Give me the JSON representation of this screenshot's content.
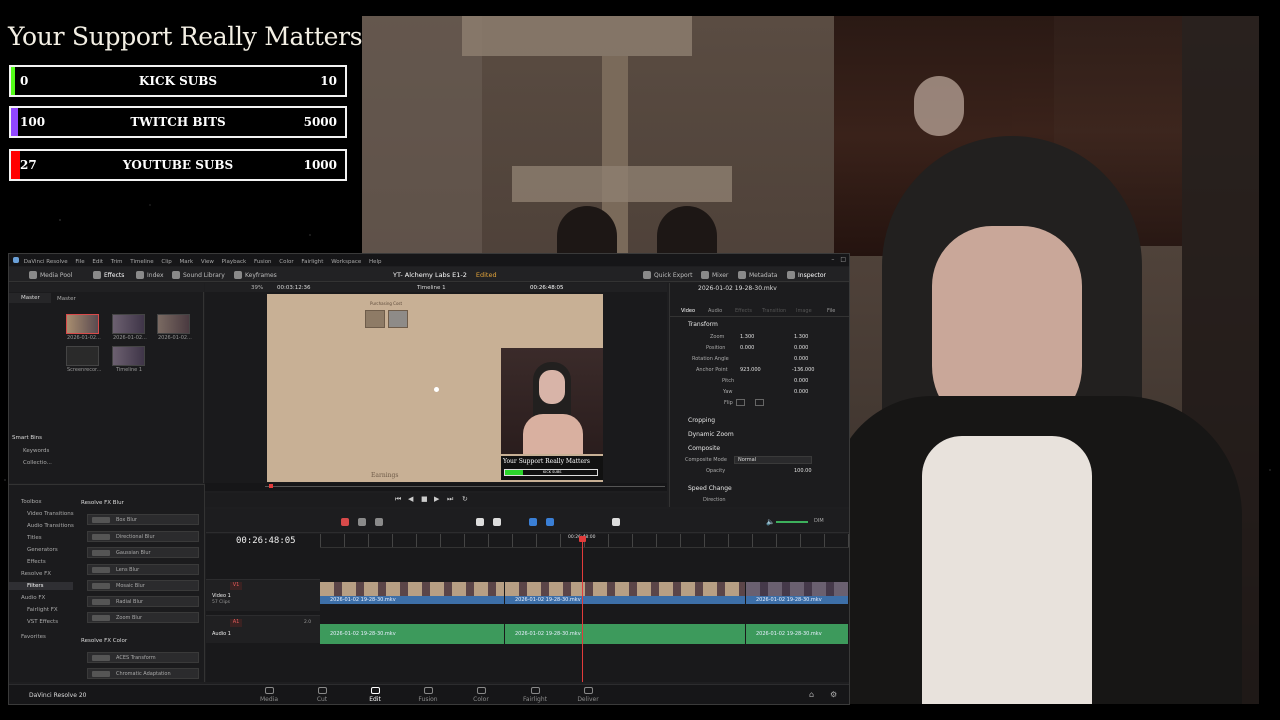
{
  "overlay": {
    "title": "Your Support Really Matters",
    "goals": [
      {
        "current": "0",
        "label": "KICK SUBS",
        "target": "10",
        "progress": 0,
        "color": "#53fc18"
      },
      {
        "current": "100",
        "label": "TWITCH BITS",
        "target": "5000",
        "progress": 0.02,
        "color": "#9146ff"
      },
      {
        "current": "27",
        "label": "YOUTUBE SUBS",
        "target": "1000",
        "progress": 0.027,
        "color": "#ff0000"
      }
    ]
  },
  "resolve": {
    "app_name": "DaVinci Resolve",
    "menu": [
      "DaVinci Resolve",
      "File",
      "Edit",
      "Trim",
      "Timeline",
      "Clip",
      "Mark",
      "View",
      "Playback",
      "Fusion",
      "Color",
      "Fairlight",
      "Workspace",
      "Help"
    ],
    "project_title": "YT- Alchemy Labs E1-2",
    "project_status": "Edited",
    "toolbar_left": [
      "Media Pool",
      "Effects",
      "Index",
      "Sound Library",
      "Keyframes"
    ],
    "toolbar_right": [
      "Quick Export",
      "Mixer",
      "Metadata",
      "Inspector"
    ],
    "bins": {
      "master": "Master",
      "crumb": "Master"
    },
    "media_clips": [
      "2026-01-02...",
      "2026-01-02...",
      "2026-01-02...",
      "Screenrecor...",
      "Timeline 1"
    ],
    "smart_bins": {
      "header": "Smart Bins",
      "items": [
        "Keywords",
        "Collectio..."
      ]
    },
    "viewer": {
      "zoom": "39%",
      "source_tc": "00:03:12:36",
      "timeline_name": "Timeline 1",
      "record_tc": "00:26:48:05",
      "game_top_text": "Purchasing Cost",
      "game_bottom_text": "Earnings",
      "inset_overlay_title": "Your Support Really Matters",
      "inset_goal_label": "KICK SUBS"
    },
    "inspector": {
      "clip_name": "2026-01-02 19-28-30.mkv",
      "tabs": [
        "Video",
        "Audio",
        "Effects",
        "Transition",
        "Image",
        "File"
      ],
      "transform": {
        "header": "Transform",
        "rows": [
          {
            "label": "Zoom",
            "x": "1.300",
            "y": "1.300"
          },
          {
            "label": "Position",
            "x": "0.000",
            "y": "0.000"
          },
          {
            "label": "Rotation Angle",
            "v": "0.000"
          },
          {
            "label": "Anchor Point",
            "x": "923.000",
            "y": "-136.000"
          },
          {
            "label": "Pitch",
            "v": "0.000"
          },
          {
            "label": "Yaw",
            "v": "0.000"
          },
          {
            "label": "Flip",
            "v": ""
          }
        ]
      },
      "sections": [
        "Cropping",
        "Dynamic Zoom",
        "Composite",
        "Speed Change"
      ],
      "composite_mode_label": "Composite Mode",
      "composite_mode": "Normal",
      "opacity_label": "Opacity",
      "opacity": "100.00",
      "direction_label": "Direction"
    },
    "toolbox": {
      "tree": [
        "Toolbox",
        "Video Transitions",
        "Audio Transitions",
        "Titles",
        "Generators",
        "Effects",
        "Resolve FX",
        "Filters",
        "Audio FX",
        "Fairlight FX",
        "VST Effects",
        "Favorites"
      ],
      "group1": "Resolve FX Blur",
      "blur_items": [
        "Box Blur",
        "Directional Blur",
        "Gaussian Blur",
        "Lens Blur",
        "Mosaic Blur",
        "Radial Blur",
        "Zoom Blur"
      ],
      "group2": "Resolve FX Color",
      "color_items": [
        "ACES Transform",
        "Chromatic Adaptation"
      ]
    },
    "timeline": {
      "timecode": "00:26:48:05",
      "playhead_tc": "00:26:48:00",
      "v1": "V1",
      "video_track": "Video 1",
      "video_clips": "57 Clips",
      "a1": "A1",
      "audio_track": "Audio 1",
      "audio_level": "2.0",
      "clip_name": "2026-01-02 19-28-30.mkv",
      "dim": "DIM"
    },
    "version": "DaVinci Resolve 20",
    "pages": [
      "Media",
      "Cut",
      "Edit",
      "Fusion",
      "Color",
      "Fairlight",
      "Deliver"
    ],
    "active_page": "Edit"
  },
  "colors": {
    "video_clip": "#3d6fa8",
    "audio_clip": "#3d9a5c",
    "playhead": "#e23b3b",
    "accent_edited": "#e3a43a"
  }
}
